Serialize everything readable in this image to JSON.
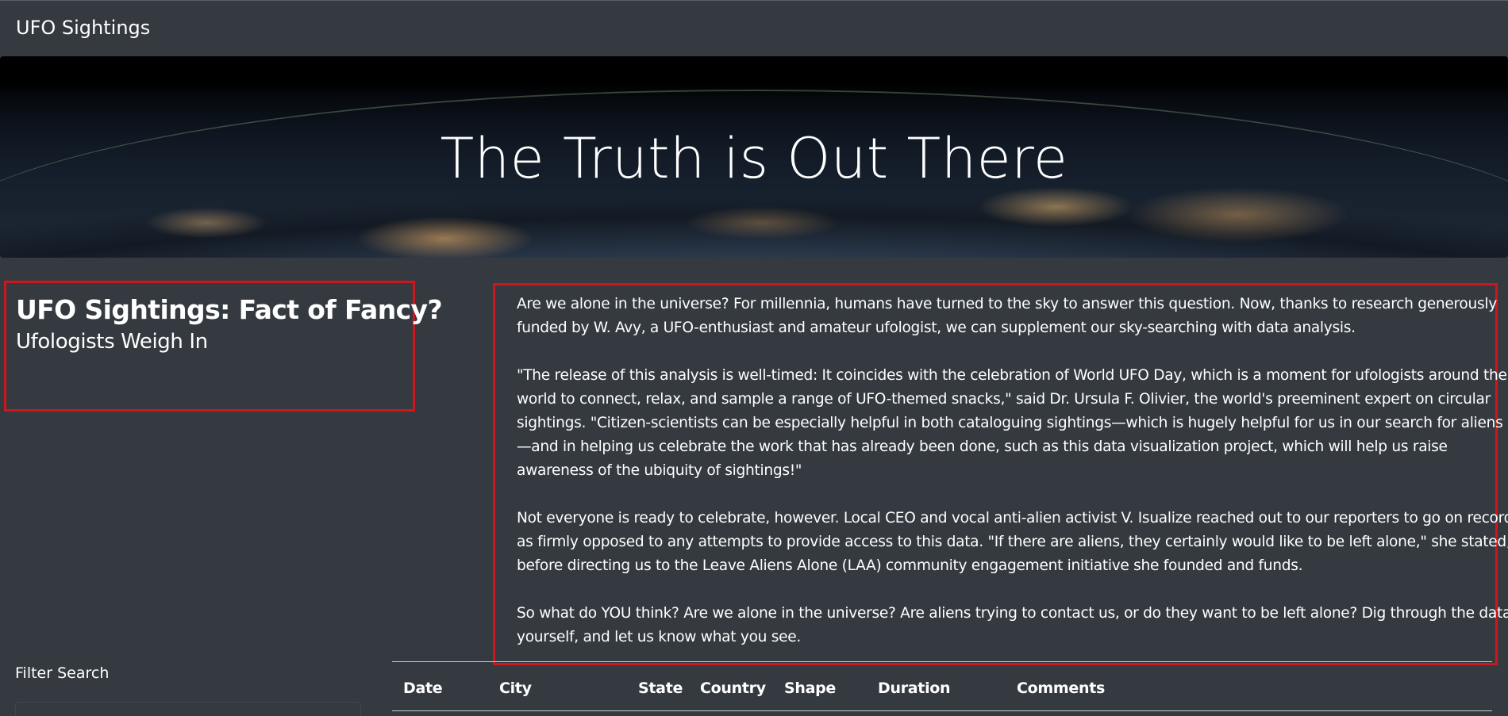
{
  "navbar": {
    "brand": "UFO Sightings"
  },
  "hero": {
    "title": "The Truth is Out There"
  },
  "heading": {
    "title": "UFO Sightings: Fact of Fancy?",
    "subtitle": "Ufologists Weigh In"
  },
  "article": {
    "paragraphs": [
      {
        "lines": [
          "Are we alone in the universe? For millennia, humans have turned to the sky to answer this question. Now, thanks to research generously",
          "funded by W. Avy, a UFO-enthusiast and amateur ufologist, we can supplement our sky-searching with data analysis."
        ]
      },
      {
        "lines": [
          "\"The release of this analysis is well-timed: It coincides with the celebration of World UFO Day, which is a moment for ufologists around the",
          "world to connect, relax, and sample a range of UFO-themed snacks,\" said Dr. Ursula F. Olivier, the world's preeminent expert on circular",
          "sightings. \"Citizen-scientists can be especially helpful in both cataloguing sightings—which is hugely helpful for us in our search for aliens",
          "—and in helping us celebrate the work that has already been done, such as this data visualization project, which will help us raise",
          "awareness of the ubiquity of sightings!\""
        ]
      },
      {
        "lines": [
          "Not everyone is ready to celebrate, however. Local CEO and vocal anti-alien activist V. Isualize reached out to our reporters to go on record",
          "as firmly opposed to any attempts to provide access to this data. \"If there are aliens, they certainly would like to be left alone,\" she stated,",
          "before directing us to the Leave Aliens Alone (LAA) community engagement initiative she founded and funds."
        ]
      },
      {
        "lines": [
          "So what do YOU think? Are we alone in the universe? Are aliens trying to contact us, or do they want to be left alone? Dig through the data",
          "yourself, and let us know what you see."
        ]
      }
    ]
  },
  "filter": {
    "label": "Filter Search"
  },
  "table": {
    "headers": [
      "Date",
      "City",
      "State",
      "Country",
      "Shape",
      "Duration",
      "Comments"
    ]
  },
  "colors": {
    "background": "#343a40",
    "highlight_border": "#d0161d",
    "text": "#ffffff"
  }
}
